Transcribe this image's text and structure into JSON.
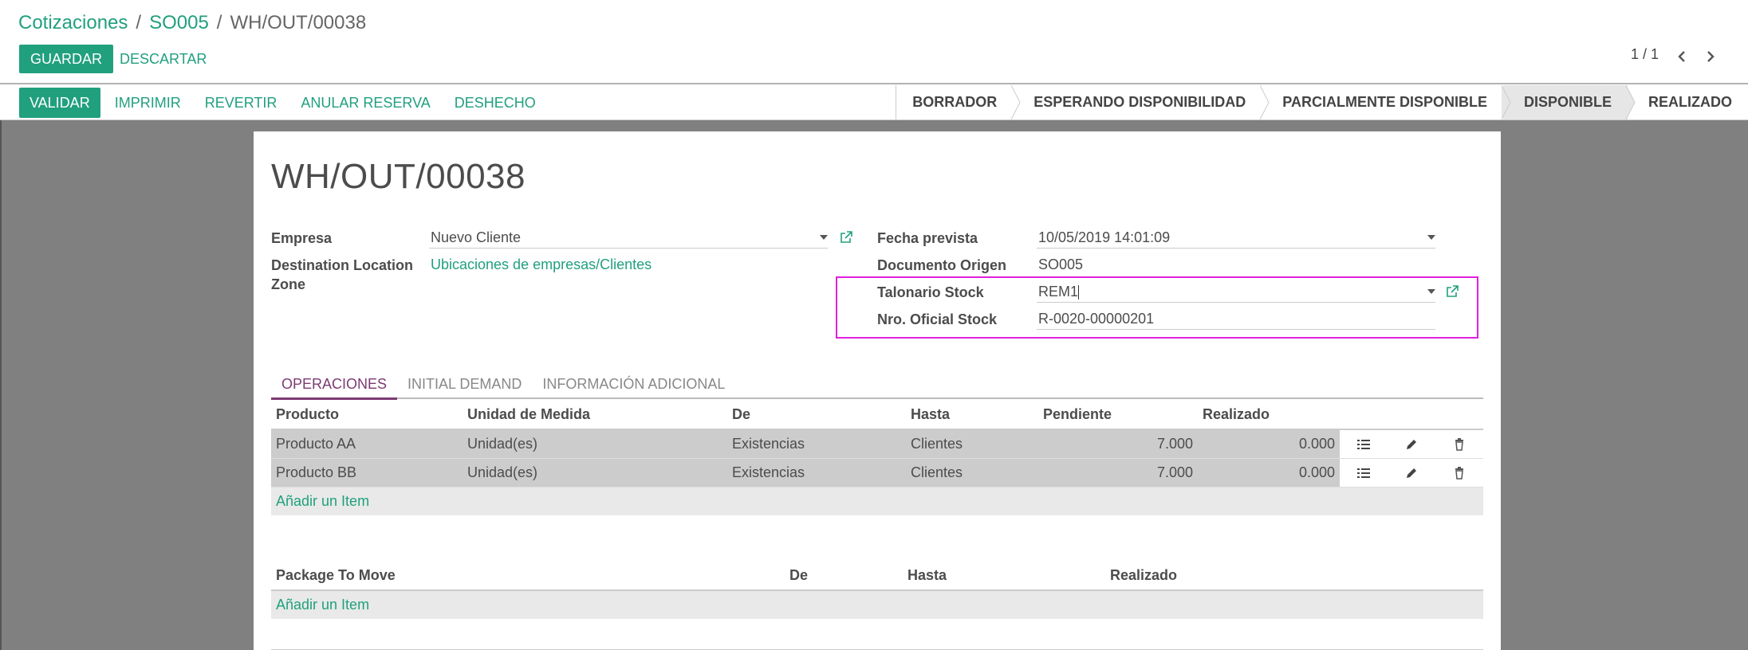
{
  "breadcrumb": {
    "items": [
      "Cotizaciones",
      "SO005"
    ],
    "current": "WH/OUT/00038",
    "separator": "/"
  },
  "toolbar": {
    "save_label": "GUARDAR",
    "discard_label": "DESCARTAR"
  },
  "pager": {
    "value": "1 / 1"
  },
  "actions": [
    "VALIDAR",
    "IMPRIMIR",
    "REVERTIR",
    "ANULAR RESERVA",
    "DESHECHO"
  ],
  "stages": [
    "BORRADOR",
    "ESPERANDO DISPONIBILIDAD",
    "PARCIALMENTE DISPONIBLE",
    "DISPONIBLE",
    "REALIZADO"
  ],
  "current_stage": "DISPONIBLE",
  "record": {
    "title": "WH/OUT/00038",
    "empresa_label": "Empresa",
    "empresa_value": "Nuevo Cliente",
    "dest_label": "Destination Location Zone",
    "dest_value": "Ubicaciones de empresas/Clientes",
    "fecha_label": "Fecha prevista",
    "fecha_value": "10/05/2019 14:01:09",
    "origen_label": "Documento Origen",
    "origen_value": "SO005",
    "talonario_label": "Talonario Stock",
    "talonario_value": "REM1",
    "nro_label": "Nro. Oficial Stock",
    "nro_value": "R-0020-00000201"
  },
  "tabs": [
    "OPERACIONES",
    "INITIAL DEMAND",
    "INFORMACIÓN ADICIONAL"
  ],
  "operations": {
    "headers": [
      "Producto",
      "Unidad de Medida",
      "De",
      "Hasta",
      "Pendiente",
      "Realizado"
    ],
    "rows": [
      [
        "Producto AA",
        "Unidad(es)",
        "Existencias",
        "Clientes",
        "7.000",
        "0.000"
      ],
      [
        "Producto BB",
        "Unidad(es)",
        "Existencias",
        "Clientes",
        "7.000",
        "0.000"
      ]
    ],
    "add_label": "Añadir un Item"
  },
  "packages": {
    "headers": [
      "Package To Move",
      "De",
      "Hasta",
      "Realizado"
    ],
    "add_label": "Añadir un Item"
  },
  "colors": {
    "accent": "#21a07e",
    "tab_active": "#7c3a73",
    "highlight": "#e020e0"
  }
}
